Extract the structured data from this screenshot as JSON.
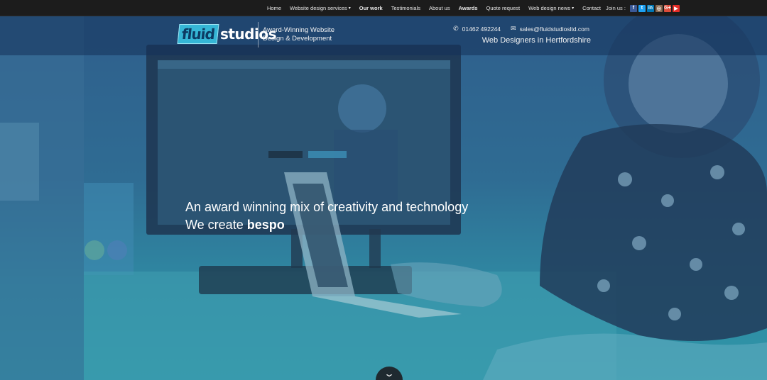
{
  "nav": {
    "items": [
      {
        "label": "Home",
        "bold": false,
        "dropdown": false
      },
      {
        "label": "Website design services",
        "bold": false,
        "dropdown": true
      },
      {
        "label": "Our work",
        "bold": true,
        "dropdown": false
      },
      {
        "label": "Testimonials",
        "bold": false,
        "dropdown": false
      },
      {
        "label": "About us",
        "bold": false,
        "dropdown": false
      },
      {
        "label": "Awards",
        "bold": true,
        "dropdown": false
      },
      {
        "label": "Quote request",
        "bold": false,
        "dropdown": false
      },
      {
        "label": "Web design news",
        "bold": false,
        "dropdown": true
      },
      {
        "label": "Contact",
        "bold": false,
        "dropdown": false
      }
    ],
    "dropdown_caret": "▾"
  },
  "social": {
    "label": "Join us :",
    "icons": [
      {
        "name": "facebook-icon",
        "glyph": "f",
        "color": "#3b5998"
      },
      {
        "name": "twitter-icon",
        "glyph": "t",
        "color": "#1da1f2"
      },
      {
        "name": "linkedin-icon",
        "glyph": "in",
        "color": "#0077b5"
      },
      {
        "name": "instagram-icon",
        "glyph": "◎",
        "color": "#8a6a52"
      },
      {
        "name": "googleplus-icon",
        "glyph": "G+",
        "color": "#dd4b39"
      },
      {
        "name": "youtube-icon",
        "glyph": "▶",
        "color": "#e52d27"
      }
    ]
  },
  "logo": {
    "fluid": "fluid",
    "studios": "studios",
    "tagline_line1": "Award-Winning Website",
    "tagline_line2": "Design & Development"
  },
  "contact": {
    "phone": "01462 492244",
    "email": "sales@fluidstudiosltd.com",
    "phone_icon": "phone-icon",
    "email_icon": "envelope-icon",
    "subtitle": "Web Designers in Hertfordshire"
  },
  "hero": {
    "line1": "An award winning mix of creativity and technology",
    "line2_prefix": "We create ",
    "line2_typed": "bespo",
    "scroll_icon": "chevron-down-icon"
  },
  "colors": {
    "accent": "#35b6d6",
    "overlay": "#2f6c93",
    "topbar": "#1c1c1c"
  }
}
